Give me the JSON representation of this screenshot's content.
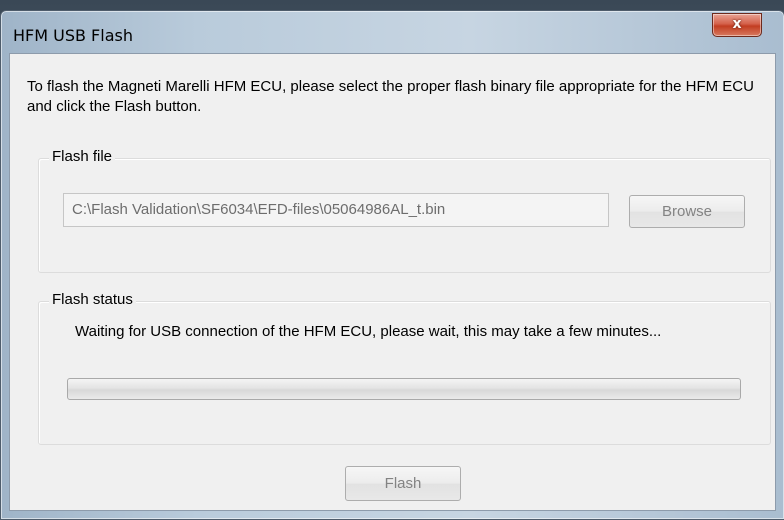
{
  "window": {
    "title": "HFM USB Flash",
    "close_label": "x"
  },
  "intro_text": "To flash the Magneti Marelli HFM ECU, please select the proper flash binary file appropriate for the HFM ECU and click the Flash button.",
  "flash_file": {
    "group_label": "Flash file",
    "path_value": "C:\\Flash Validation\\SF6034\\EFD-files\\05064986AL_t.bin",
    "browse_label": "Browse",
    "browse_enabled": false
  },
  "flash_status": {
    "group_label": "Flash status",
    "message": "Waiting for USB connection of the HFM ECU, please wait, this may take a few minutes...",
    "progress": 0
  },
  "actions": {
    "flash_label": "Flash",
    "flash_enabled": false
  },
  "colors": {
    "close_button": "#c94a33",
    "dialog_background": "#f0f0f0",
    "disabled_text": "#838383"
  }
}
